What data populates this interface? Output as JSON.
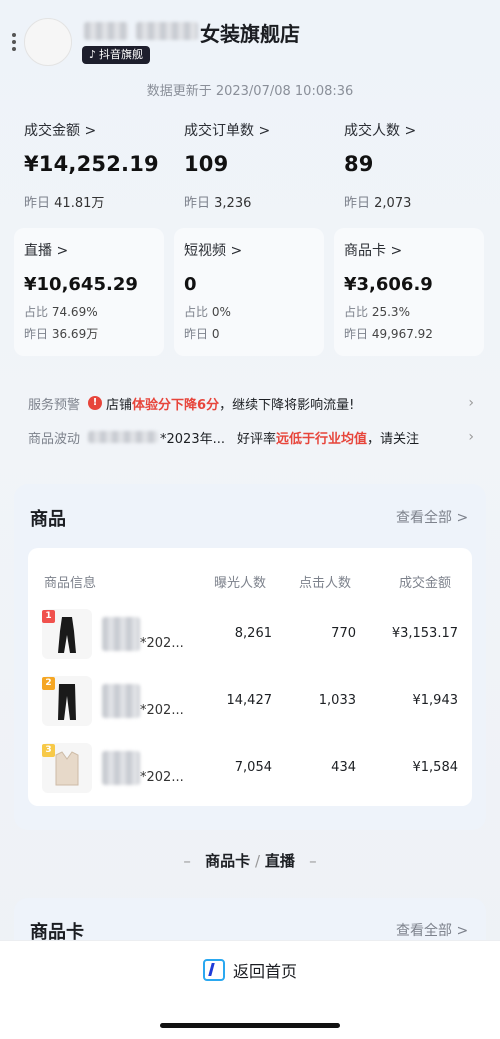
{
  "header": {
    "store_suffix": "女装旗舰店",
    "badge": "抖音旗舰",
    "updated": "数据更新于 2023/07/08 10:08:36"
  },
  "metrics": [
    {
      "label": "成交金额 >",
      "value": "¥14,252.19",
      "sub_label": "昨日",
      "sub_value": "41.81万"
    },
    {
      "label": "成交订单数 >",
      "value": "109",
      "sub_label": "昨日",
      "sub_value": "3,236"
    },
    {
      "label": "成交人数 >",
      "value": "89",
      "sub_label": "昨日",
      "sub_value": "2,073"
    }
  ],
  "channels": [
    {
      "label": "直播 >",
      "value": "¥10,645.29",
      "share_label": "占比",
      "share": "74.69%",
      "y_label": "昨日",
      "y_value": "36.69万"
    },
    {
      "label": "短视频 >",
      "value": "0",
      "share_label": "占比",
      "share": "0%",
      "y_label": "昨日",
      "y_value": "0"
    },
    {
      "label": "商品卡 >",
      "value": "¥3,606.9",
      "share_label": "占比",
      "share": "25.3%",
      "y_label": "昨日",
      "y_value": "49,967.92"
    }
  ],
  "alerts": {
    "service": {
      "tag": "服务预警",
      "pre": "店铺",
      "red": "体验分下降6分",
      "post": "，继续下降将影响流量!"
    },
    "product": {
      "tag": "商品波动",
      "item": "*2023年...",
      "pre": "好评率",
      "red": "远低于行业均值",
      "post": "，请关注"
    }
  },
  "products": {
    "title": "商品",
    "view_all": "查看全部 >",
    "columns": [
      "商品信息",
      "曝光人数",
      "点击人数",
      "成交金额"
    ],
    "rows": [
      {
        "rank": "1",
        "name": "*202...",
        "exposure": "8,261",
        "clicks": "770",
        "amount": "¥3,153.17"
      },
      {
        "rank": "2",
        "name": "*202...",
        "exposure": "14,427",
        "clicks": "1,033",
        "amount": "¥1,943"
      },
      {
        "rank": "3",
        "name": "*202...",
        "exposure": "7,054",
        "clicks": "434",
        "amount": "¥1,584"
      }
    ]
  },
  "tabs": {
    "a": "商品卡",
    "sep": "/",
    "b": "直播"
  },
  "card_section": {
    "title": "商品卡",
    "view_all": "查看全部 >"
  },
  "bottom": {
    "home": "返回首页"
  },
  "colors": {
    "accent_red": "#e7453b",
    "rank1": "#f0514d",
    "rank2": "#f5a623",
    "rank3": "#f7c948",
    "brand_blue": "#2aa8f0"
  }
}
